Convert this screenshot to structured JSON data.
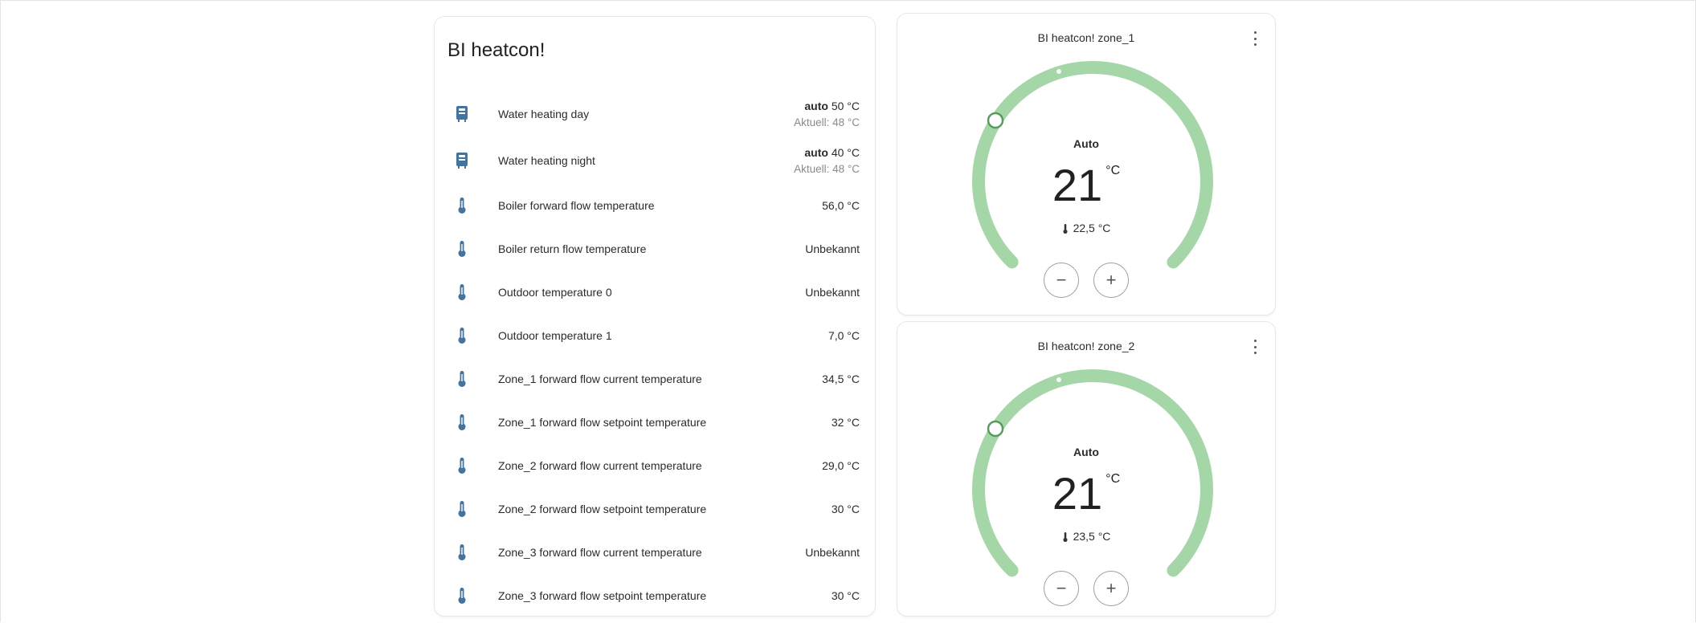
{
  "entities_card": {
    "title": "BI heatcon!",
    "rows": [
      {
        "icon": "water-heater-icon",
        "name": "Water heating day",
        "state_mode": "auto",
        "state_value": "50 °C",
        "state_sub": "Aktuell: 48 °C"
      },
      {
        "icon": "water-heater-icon",
        "name": "Water heating night",
        "state_mode": "auto",
        "state_value": "40 °C",
        "state_sub": "Aktuell: 48 °C"
      },
      {
        "icon": "thermometer-icon",
        "name": "Boiler forward flow temperature",
        "state": "56,0 °C"
      },
      {
        "icon": "thermometer-icon",
        "name": "Boiler return flow temperature",
        "state": "Unbekannt"
      },
      {
        "icon": "thermometer-icon",
        "name": "Outdoor temperature 0",
        "state": "Unbekannt"
      },
      {
        "icon": "thermometer-icon",
        "name": "Outdoor temperature 1",
        "state": "7,0 °C"
      },
      {
        "icon": "thermometer-icon",
        "name": "Zone_1 forward flow current temperature",
        "state": "34,5 °C"
      },
      {
        "icon": "thermometer-icon",
        "name": "Zone_1 forward flow setpoint temperature",
        "state": "32 °C"
      },
      {
        "icon": "thermometer-icon",
        "name": "Zone_2 forward flow current temperature",
        "state": "29,0 °C"
      },
      {
        "icon": "thermometer-icon",
        "name": "Zone_2 forward flow setpoint temperature",
        "state": "30 °C"
      },
      {
        "icon": "thermometer-icon",
        "name": "Zone_3 forward flow current temperature",
        "state": "Unbekannt"
      },
      {
        "icon": "thermometer-icon",
        "name": "Zone_3 forward flow setpoint temperature",
        "state": "30 °C"
      }
    ]
  },
  "thermostats": [
    {
      "title": "BI heatcon! zone_1",
      "mode": "Auto",
      "target": "21",
      "unit": "°C",
      "current": "22,5 °C",
      "minus_label": "−",
      "plus_label": "+",
      "menu_icon": "dots-vertical-icon",
      "setpoint_fraction": 0.15
    },
    {
      "title": "BI heatcon! zone_2",
      "mode": "Auto",
      "target": "21",
      "unit": "°C",
      "current": "23,5 °C",
      "minus_label": "−",
      "plus_label": "+",
      "menu_icon": "dots-vertical-icon",
      "setpoint_fraction": 0.15
    }
  ],
  "colors": {
    "arc": "#a5d6a7",
    "icon_blue": "#44739e"
  }
}
